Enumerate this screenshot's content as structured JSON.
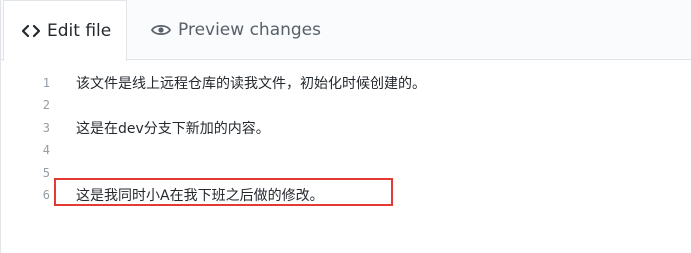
{
  "tabs": [
    {
      "label": "Edit file",
      "icon": "code-icon",
      "active": true
    },
    {
      "label": "Preview changes",
      "icon": "eye-icon",
      "active": false
    }
  ],
  "editor": {
    "lines": [
      {
        "number": "1",
        "text": "该文件是线上远程仓库的读我文件，初始化时候创建的。"
      },
      {
        "number": "2",
        "text": ""
      },
      {
        "number": "3",
        "text": "这是在dev分支下新加的内容。"
      },
      {
        "number": "4",
        "text": ""
      },
      {
        "number": "5",
        "text": ""
      },
      {
        "number": "6",
        "text": "这是我同时小A在我下班之后做的修改。"
      }
    ]
  },
  "colors": {
    "highlight_border": "#e53935",
    "tab_bar_background": "#fafbfc",
    "line_number": "#959da5"
  }
}
